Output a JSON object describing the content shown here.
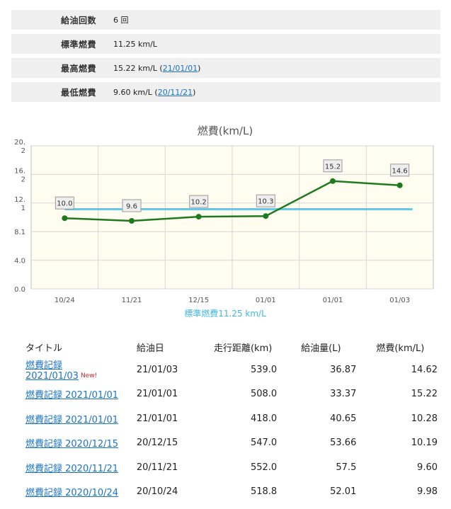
{
  "summary": {
    "rows": [
      {
        "label": "給油回数",
        "value": "6 回",
        "link": ""
      },
      {
        "label": "標準燃費",
        "value": "11.25 km/L",
        "link": ""
      },
      {
        "label": "最高燃費",
        "value": "15.22 km/L (",
        "link": "21/01/01",
        "suffix": ")"
      },
      {
        "label": "最低燃費",
        "value": "9.60 km/L (",
        "link": "20/11/21",
        "suffix": ")"
      }
    ]
  },
  "chart_data": {
    "type": "line",
    "title": "燃費(km/L)",
    "categories": [
      "10/24",
      "11/21",
      "12/15",
      "01/01",
      "01/01",
      "01/03"
    ],
    "series": [
      {
        "values": [
          9.98,
          9.6,
          10.19,
          10.28,
          15.22,
          14.62
        ],
        "color": "#1f7a1f"
      }
    ],
    "data_labels": [
      "10.0",
      "9.6",
      "10.2",
      "10.3",
      "15.2",
      "14.6"
    ],
    "reference_line": {
      "value": 11.25,
      "label": "標準燃費11.25 km/L",
      "color": "#64c8e8"
    },
    "y_tick_labels": [
      "20.\n2",
      "16.\n2",
      "12.\n1",
      "8.1",
      "4.0",
      "0.0"
    ],
    "ylim": [
      0,
      20.2
    ],
    "grid": true
  },
  "table": {
    "headers": {
      "title": "タイトル",
      "date": "給油日",
      "distance": "走行距離(km)",
      "volume": "給油量(L)",
      "efficiency": "燃費(km/L)"
    },
    "new_badge": "New!",
    "rows": [
      {
        "title": "燃費記録 2021/01/03",
        "is_new": true,
        "date": "21/01/03",
        "distance": "539.0",
        "volume": "36.87",
        "efficiency": "14.62"
      },
      {
        "title": "燃費記録 2021/01/01",
        "is_new": false,
        "date": "21/01/01",
        "distance": "508.0",
        "volume": "33.37",
        "efficiency": "15.22"
      },
      {
        "title": "燃費記録 2021/01/01",
        "is_new": false,
        "date": "21/01/01",
        "distance": "418.0",
        "volume": "40.65",
        "efficiency": "10.28"
      },
      {
        "title": "燃費記録 2020/12/15",
        "is_new": false,
        "date": "20/12/15",
        "distance": "547.0",
        "volume": "53.66",
        "efficiency": "10.19"
      },
      {
        "title": "燃費記録 2020/11/21",
        "is_new": false,
        "date": "20/11/21",
        "distance": "552.0",
        "volume": "57.5",
        "efficiency": "9.60"
      },
      {
        "title": "燃費記録 2020/10/24",
        "is_new": false,
        "date": "20/10/24",
        "distance": "518.8",
        "volume": "52.01",
        "efficiency": "9.98"
      }
    ]
  }
}
